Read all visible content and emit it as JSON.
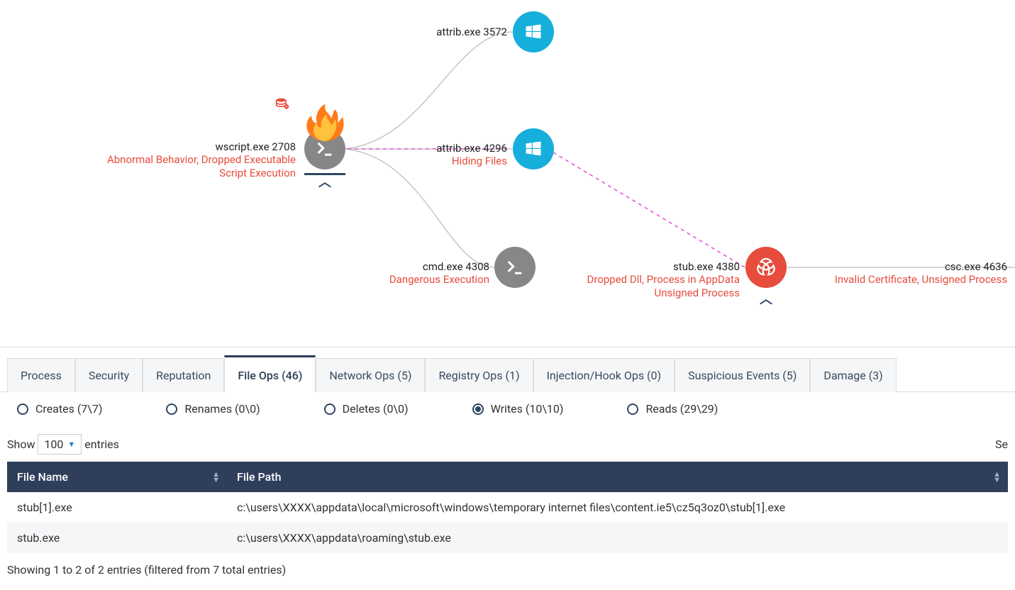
{
  "graph": {
    "nodes": {
      "wscript": {
        "label": "wscript.exe 2708",
        "alert": "Abnormal Behavior, Dropped Executable\nScript Execution"
      },
      "attrib1": {
        "label": "attrib.exe 3572",
        "alert": ""
      },
      "attrib2": {
        "label": "attrib.exe 4296",
        "alert": "Hiding Files"
      },
      "cmd": {
        "label": "cmd.exe 4308",
        "alert": "Dangerous Execution"
      },
      "stub": {
        "label": "stub.exe 4380",
        "alert": "Dropped Dll, Process in AppData\nUnsigned Process"
      },
      "csc": {
        "label": "csc.exe 4636",
        "alert": "Invalid Certificate, Unsigned Process"
      }
    }
  },
  "tabs": [
    {
      "label": "Process",
      "active": false
    },
    {
      "label": "Security",
      "active": false
    },
    {
      "label": "Reputation",
      "active": false
    },
    {
      "label": "File Ops (46)",
      "active": true
    },
    {
      "label": "Network Ops (5)",
      "active": false
    },
    {
      "label": "Registry Ops (1)",
      "active": false
    },
    {
      "label": "Injection/Hook Ops (0)",
      "active": false
    },
    {
      "label": "Suspicious Events (5)",
      "active": false
    },
    {
      "label": "Damage (3)",
      "active": false
    }
  ],
  "filters": [
    {
      "label": "Creates (7\\7)",
      "checked": false
    },
    {
      "label": "Renames (0\\0)",
      "checked": false
    },
    {
      "label": "Deletes (0\\0)",
      "checked": false
    },
    {
      "label": "Writes (10\\10)",
      "checked": true
    },
    {
      "label": "Reads (29\\29)",
      "checked": false
    }
  ],
  "table_controls": {
    "show_label": "Show",
    "page_size": "100",
    "entries_label": "entries",
    "search_label": "Se"
  },
  "table": {
    "headers": {
      "name": "File Name",
      "path": "File Path"
    },
    "rows": [
      {
        "name": "stub[1].exe",
        "path": "c:\\users\\XXXX\\appdata\\local\\microsoft\\windows\\temporary internet files\\content.ie5\\cz5q3oz0\\stub[1].exe"
      },
      {
        "name": "stub.exe",
        "path": "c:\\users\\XXXX\\appdata\\roaming\\stub.exe"
      }
    ]
  },
  "footer": "Showing 1 to 2 of 2 entries (filtered from 7 total entries)"
}
